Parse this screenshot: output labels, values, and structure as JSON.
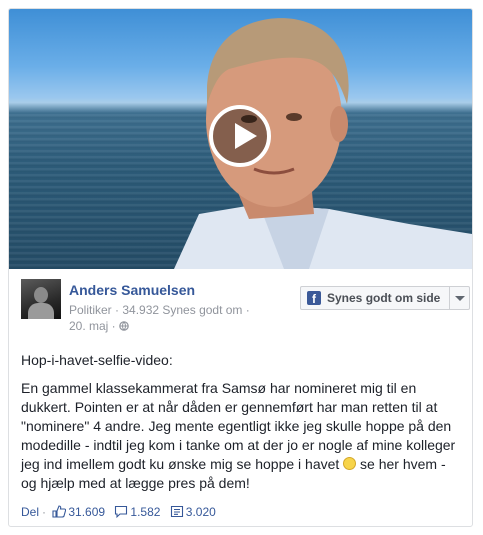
{
  "video": {
    "play_icon": "play-icon"
  },
  "post": {
    "author": "Anders Samuelsen",
    "meta": "Politiker · 34.932 Synes godt om · 20. maj · ",
    "meta_icon": "globe-icon",
    "like_page_label": "Synes godt om side",
    "paragraphs": {
      "p1": "Hop-i-havet-selfie-video:",
      "p2": "En gammel klassekammerat fra Samsø har nomineret mig til en dukkert. Pointen er at når dåden er gennemført har man retten til at \"nominere\" 4 andre. Jeg mente egentligt ikke jeg skulle hoppe på den modedille - indtil jeg kom i tanke om at der jo er nogle af mine kolleger jeg ind imellem godt ku ønske mig se hoppe i havet",
      "p2_end": " se her hvem - og hjælp med at lægge pres på dem!"
    }
  },
  "footer": {
    "share_label": "Del",
    "likes": "31.609",
    "comments": "1.582",
    "shares": "3.020"
  },
  "colors": {
    "link": "#365899",
    "muted": "#90949c",
    "facebook_blue": "#3b5998"
  }
}
